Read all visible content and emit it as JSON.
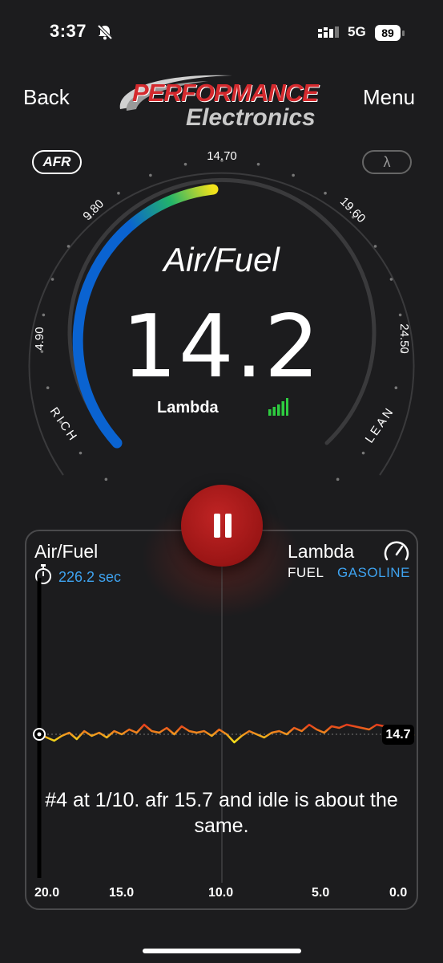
{
  "status_bar": {
    "time": "3:37",
    "network": "5G",
    "battery": "89"
  },
  "nav": {
    "back_label": "Back",
    "menu_label": "Menu"
  },
  "logo": {
    "line1": "PERFORMANCE",
    "line2": "Electronics"
  },
  "gauge": {
    "unit_afr": "AFR",
    "unit_lambda": "λ",
    "title": "Air/Fuel",
    "value": "14.2",
    "sublabel": "Lambda",
    "rich_label": "RICH",
    "lean_label": "LEAN",
    "ticks": [
      "4.90",
      "9.80",
      "14.70",
      "19.60",
      "24.50"
    ],
    "scale_min": 4.9,
    "scale_max": 24.5,
    "current": 14.2,
    "colors": {
      "rich": "#0a63d1",
      "mid": "#23b46a",
      "target": "#f2e21b",
      "track": "#3a3a3c"
    }
  },
  "chart": {
    "title": "Air/Fuel",
    "elapsed": "226.2 sec",
    "mode": "Lambda",
    "fuel_label": "FUEL",
    "fuel_value": "GASOLINE",
    "current_badge": "14.7",
    "x_ticks": [
      "20.0",
      "15.0",
      "10.0",
      "5.0",
      "0.0"
    ],
    "note": "#4 at 1/10. afr 15.7 and idle is about the same.",
    "line_colors": {
      "low": "#f2e21b",
      "mid": "#f08a1d",
      "high": "#e02a1c"
    }
  },
  "chart_data": {
    "type": "line",
    "title": "Air/Fuel",
    "xlabel": "",
    "ylabel": "",
    "x_reversed": true,
    "xlim": [
      20.0,
      0.0
    ],
    "ylim": [
      10.0,
      20.0
    ],
    "reference_line": 14.7,
    "series": [
      {
        "x": [
          20.0,
          19.6,
          19.2,
          18.8,
          18.4,
          18.0,
          17.6,
          17.2,
          16.8,
          16.4,
          16.0,
          15.6,
          15.2,
          14.8,
          14.4,
          14.0,
          13.6,
          13.2,
          12.8,
          12.4,
          12.0,
          11.6,
          11.2,
          10.8,
          10.4,
          10.0,
          9.6,
          9.2,
          8.8,
          8.4,
          8.0,
          7.6,
          7.2,
          6.8,
          6.4,
          6.0,
          5.6,
          5.2,
          4.8,
          4.4,
          4.0,
          3.6,
          3.2,
          2.8,
          2.4,
          2.0,
          1.6,
          1.2,
          0.8,
          0.4,
          0.0
        ],
        "values": [
          14.7,
          14.5,
          14.3,
          14.6,
          14.8,
          14.4,
          14.9,
          14.6,
          14.8,
          14.5,
          14.9,
          14.7,
          15.0,
          14.8,
          15.3,
          14.9,
          14.8,
          15.1,
          14.7,
          15.2,
          14.9,
          14.8,
          14.9,
          14.6,
          15.0,
          14.7,
          14.2,
          14.6,
          14.9,
          14.7,
          14.5,
          14.8,
          14.9,
          14.7,
          15.1,
          14.9,
          15.3,
          15.0,
          14.8,
          15.2,
          15.1,
          15.3,
          15.2,
          15.1,
          15.0,
          15.3,
          15.2,
          14.9,
          15.0,
          14.6,
          14.7
        ]
      }
    ]
  }
}
